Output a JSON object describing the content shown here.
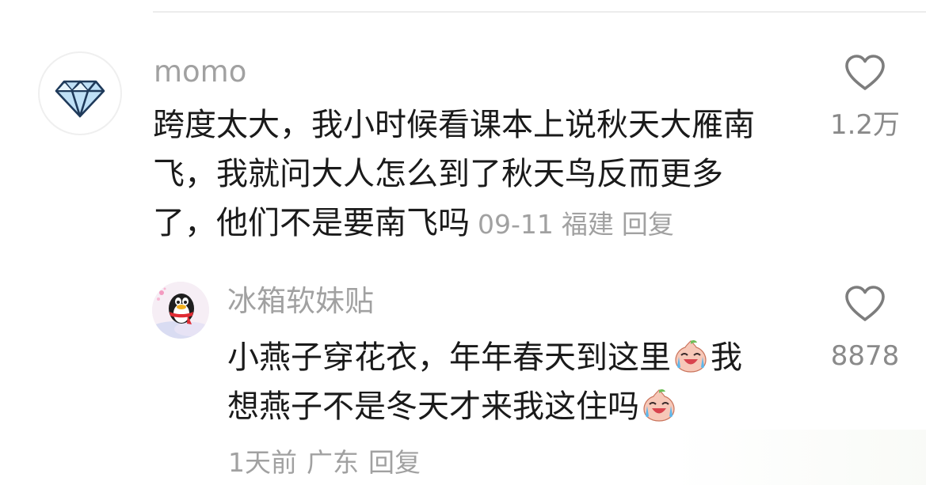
{
  "comments": [
    {
      "username": "momo",
      "avatar_icon": "diamond-icon",
      "lines": [
        "跨度太大，我小时候看课本上说秋天大雁南",
        "飞，我就问大人怎么到了秋天鸟反而更多",
        "了，他们不是要南飞吗"
      ],
      "date": "09-11",
      "location": "福建",
      "reply_label": "回复",
      "likes": "1.2万",
      "like_icon": "heart-icon"
    },
    {
      "username": "冰箱软妹贴",
      "avatar_icon": "penguin-avatar-icon",
      "line1_before_emoji": "小燕子穿花衣，年年春天到这里",
      "line1_after_emoji": "我",
      "line2_before_emoji": "想燕子不是冬天才来我这住吗",
      "emoji_icon": "crying-laughing-peach-emoji-icon",
      "time": "1天前",
      "location": "广东",
      "reply_label": "回复",
      "likes": "8878",
      "like_icon": "heart-icon"
    }
  ],
  "colors": {
    "text": "#1a1a1a",
    "meta": "#a1a1a1",
    "like_count": "#8a8a8a",
    "divider": "#ececec"
  }
}
